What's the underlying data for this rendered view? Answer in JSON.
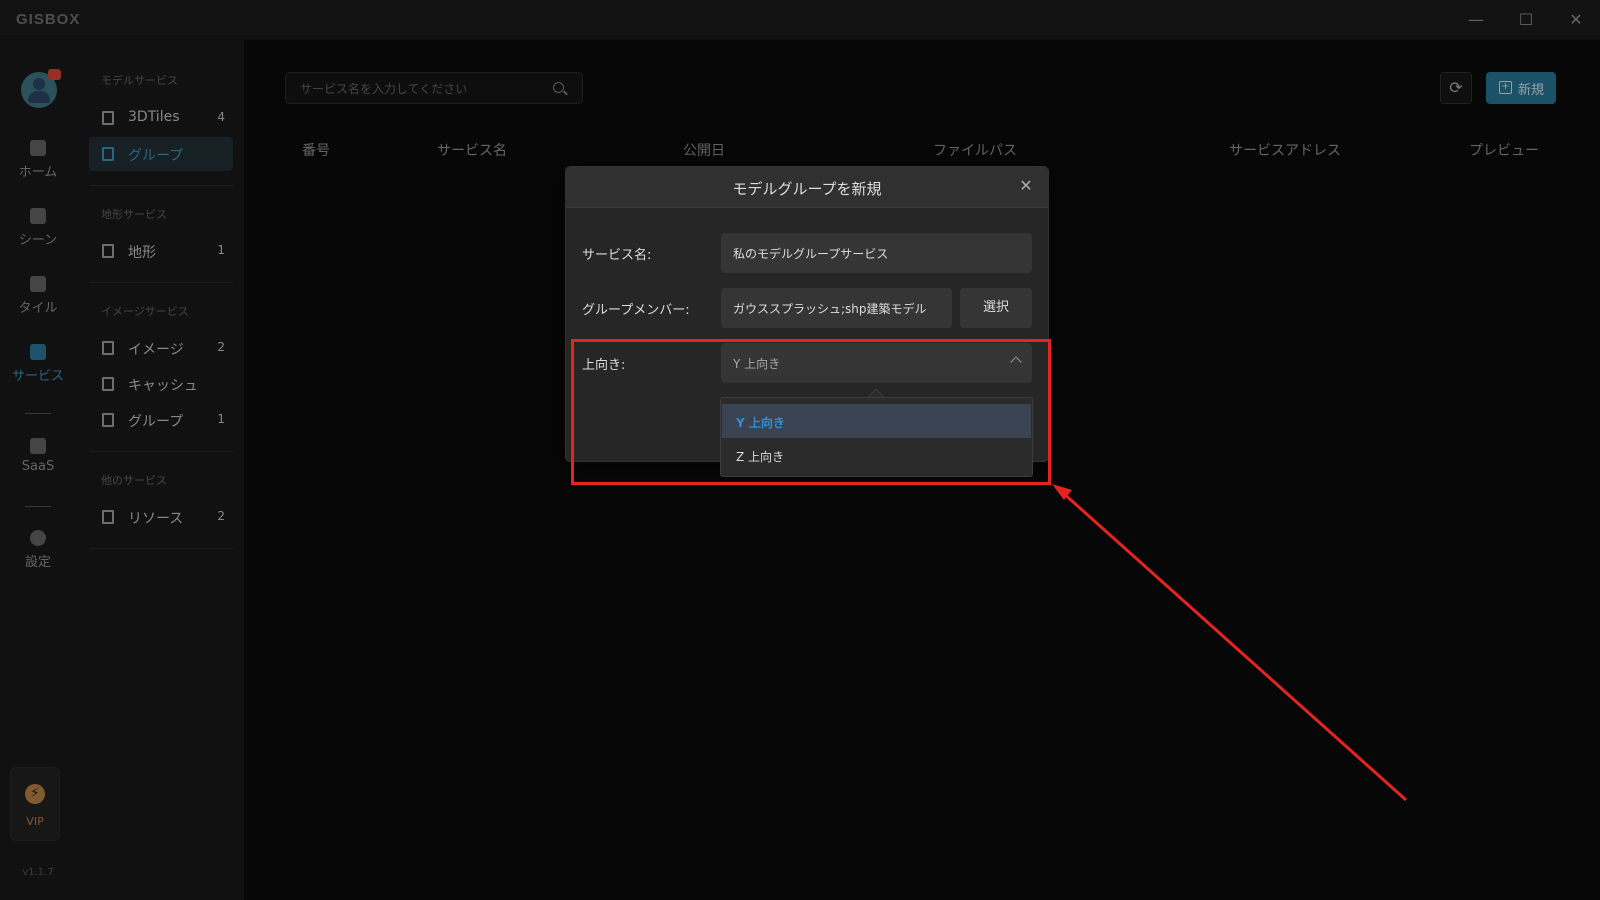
{
  "app": {
    "logo": "GISBOX",
    "version": "v1.1.7"
  },
  "window": {
    "minimize": "—",
    "maximize": "☐",
    "close": "✕"
  },
  "rail": {
    "items": [
      {
        "label": "ホーム",
        "icon": "home-icon"
      },
      {
        "label": "シーン",
        "icon": "scene-icon"
      },
      {
        "label": "タイル",
        "icon": "tile-icon"
      },
      {
        "label": "サービス",
        "icon": "service-icon",
        "active": true
      },
      {
        "label": "SaaS",
        "icon": "lock-icon"
      },
      {
        "label": "設定",
        "icon": "gear-icon"
      }
    ],
    "vip": {
      "label": "VIP",
      "icon": "bolt-icon",
      "glyph": "⚡"
    }
  },
  "panel": {
    "model_section": "モデルサービス",
    "terrain_section": "地形サービス",
    "image_section": "イメージサービス",
    "other_section": "他のサービス",
    "items": [
      {
        "label": "3DTiles",
        "count": "4"
      },
      {
        "label": "グループ",
        "count": "",
        "active": true
      },
      {
        "label": "地形",
        "count": "1"
      },
      {
        "label": "イメージ",
        "count": "2"
      },
      {
        "label": "キャッシュ",
        "count": ""
      },
      {
        "label": "グループ",
        "count": "1"
      },
      {
        "label": "リソース",
        "count": "2"
      }
    ]
  },
  "toolbar": {
    "search_placeholder": "サービス名を入力してください",
    "refresh_glyph": "⟳",
    "new_label": "新規",
    "new_glyph": "+"
  },
  "table": {
    "headers": [
      "番号",
      "サービス名",
      "公開日",
      "ファイルパス",
      "サービスアドレス",
      "プレビュー"
    ]
  },
  "modal": {
    "title": "モデルグループを新規",
    "close_glyph": "✕",
    "service_name_label": "サービス名:",
    "service_name_value": "私のモデルグループサービス",
    "members_label": "グループメンバー:",
    "members_value": "ガウススプラッシュ;shp建築モデル",
    "select_button": "選択",
    "up_axis_label": "上向き:",
    "up_axis_value": "Y 上向き"
  },
  "dropdown": {
    "options": [
      {
        "label": "Y 上向き",
        "selected": true
      },
      {
        "label": "Z 上向き",
        "selected": false
      }
    ]
  },
  "colors": {
    "accent": "#2a7fa0",
    "selected_option": "#2f8fd8",
    "annotation": "#e4241f"
  }
}
